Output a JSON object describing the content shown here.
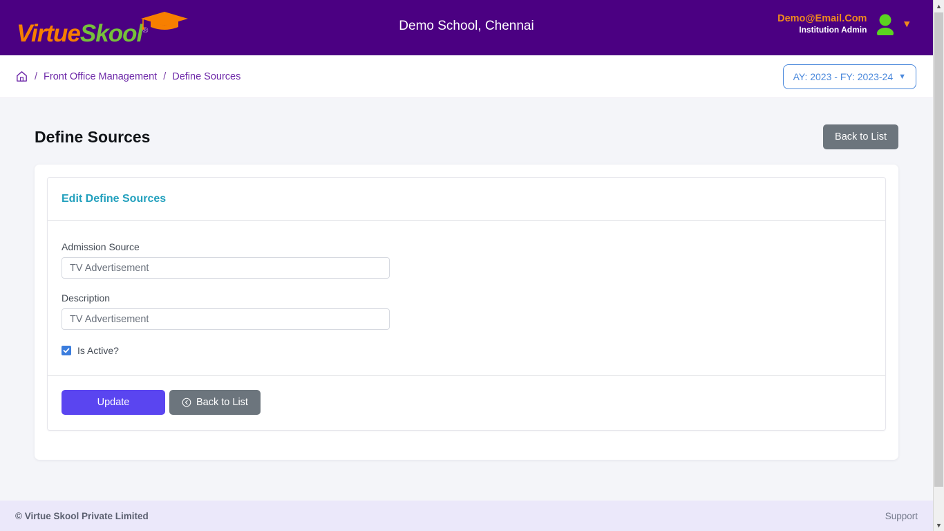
{
  "header": {
    "brand": {
      "part1": "Virtue",
      "part2": "Skool",
      "registered": "®",
      "cap_icon": "graduation-cap-icon"
    },
    "school_title": "Demo School, Chennai",
    "user": {
      "email": "Demo@Email.Com",
      "role": "Institution Admin",
      "avatar_icon": "user-avatar-icon",
      "chevron_icon": "chevron-down-icon"
    }
  },
  "breadcrumb": {
    "home_icon": "home-icon",
    "separator": "/",
    "items": [
      {
        "label": "Front Office Management"
      },
      {
        "label": "Define Sources"
      }
    ]
  },
  "year_selector": {
    "label": "AY: 2023 - FY: 2023-24",
    "chevron": "⌄",
    "color": "#4b89dc"
  },
  "page": {
    "title": "Define Sources",
    "back_to_list_top": "Back to List"
  },
  "form_card": {
    "title": "Edit Define Sources",
    "title_color": "#22a0bd",
    "fields": [
      {
        "label": "Admission Source",
        "value": "TV Advertisement",
        "placeholder": "Admission Source"
      },
      {
        "label": "Description",
        "value": "TV Advertisement",
        "placeholder": "Description"
      }
    ],
    "checkbox": {
      "label": "Is Active?",
      "checked": true,
      "color": "#3b7ddd"
    },
    "buttons": {
      "update": "Update",
      "back_to_list": "Back to List",
      "back_icon": "circle-arrow-left-icon"
    }
  },
  "footer": {
    "copyright": "© Virtue Skool Private Limited",
    "support": "Support"
  },
  "colors": {
    "header_purple": "#4b0082",
    "brand_orange": "#f77f00",
    "brand_green": "#76c13b",
    "primary_purple": "#5a45f0",
    "grey_button": "#6c757d",
    "footer_bg": "#ebe8fa",
    "page_bg": "#f4f5f9"
  },
  "scrollbar": {
    "up_arrow": "▲",
    "down_arrow": "▼"
  }
}
